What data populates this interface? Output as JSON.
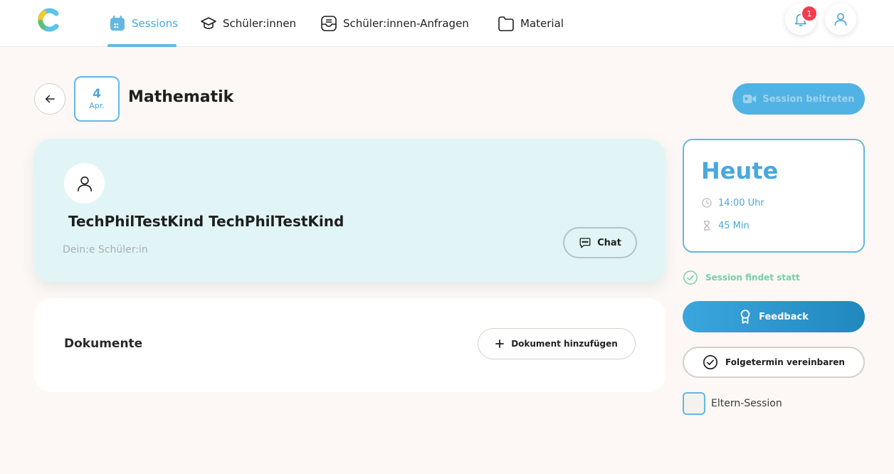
{
  "nav": {
    "items": [
      {
        "label": "Sessions",
        "icon": "calendar-icon",
        "active": true
      },
      {
        "label": "Schüler:innen",
        "icon": "graduation-cap-icon",
        "active": false
      },
      {
        "label": "Schüler:innen-Anfragen",
        "icon": "inbox-icon",
        "active": false
      },
      {
        "label": "Material",
        "icon": "folder-icon",
        "active": false
      }
    ],
    "notification_count": "1"
  },
  "header": {
    "date_day": "4",
    "date_month": "Apr.",
    "title": "Mathematik",
    "join_label": "Session beitreten"
  },
  "student": {
    "name": "TechPhilTestKind TechPhilTestKind",
    "role": "Dein:e Schüler:in",
    "chat_label": "Chat"
  },
  "documents": {
    "title": "Dokumente",
    "add_label": "Dokument hinzufügen"
  },
  "session_info": {
    "day_label": "Heute",
    "time": "14:00 Uhr",
    "duration": "45 Min",
    "status": "Session findet statt",
    "feedback_label": "Feedback",
    "followup_label": "Folgetermin vereinbaren",
    "parent_session_label": "Eltern-Session",
    "parent_session_checked": false
  },
  "colors": {
    "accent": "#4ba8db",
    "student_card_bg": "#e1f5f7",
    "status_green": "#74cfa7",
    "badge_red": "#f13d4f",
    "page_bg": "#fdf8f5"
  }
}
